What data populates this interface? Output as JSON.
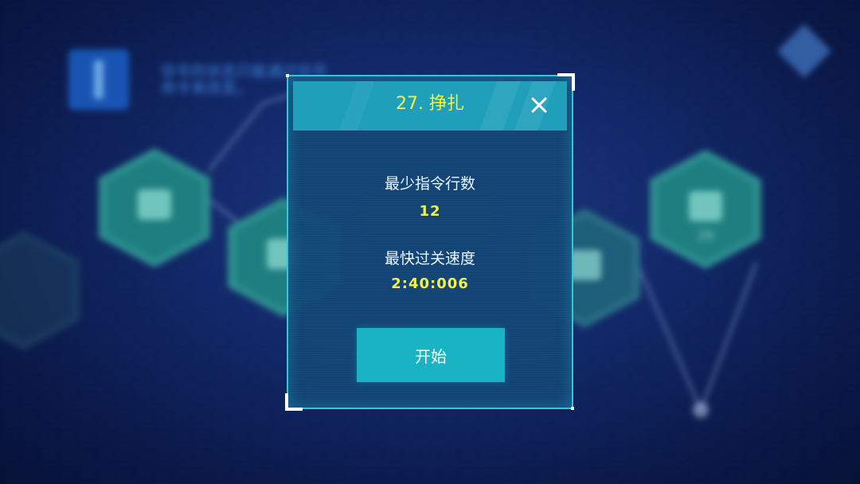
{
  "background": {
    "hint_text": "信号的状态只能通过信号\n命令来改变。",
    "node_numbers": [
      "29"
    ]
  },
  "dialog": {
    "title": "27. 挣扎",
    "close_icon": "close-icon",
    "min_lines_label": "最少指令行数",
    "min_lines_value": "12",
    "best_time_label": "最快过关速度",
    "best_time_value": "2:40:006",
    "start_label": "开始"
  },
  "colors": {
    "accent_yellow": "#f3f14a",
    "frame_cyan": "#33c6d6",
    "header_teal": "#1f9fba",
    "button_teal": "#19b3c3",
    "panel_blue": "#12467a"
  }
}
